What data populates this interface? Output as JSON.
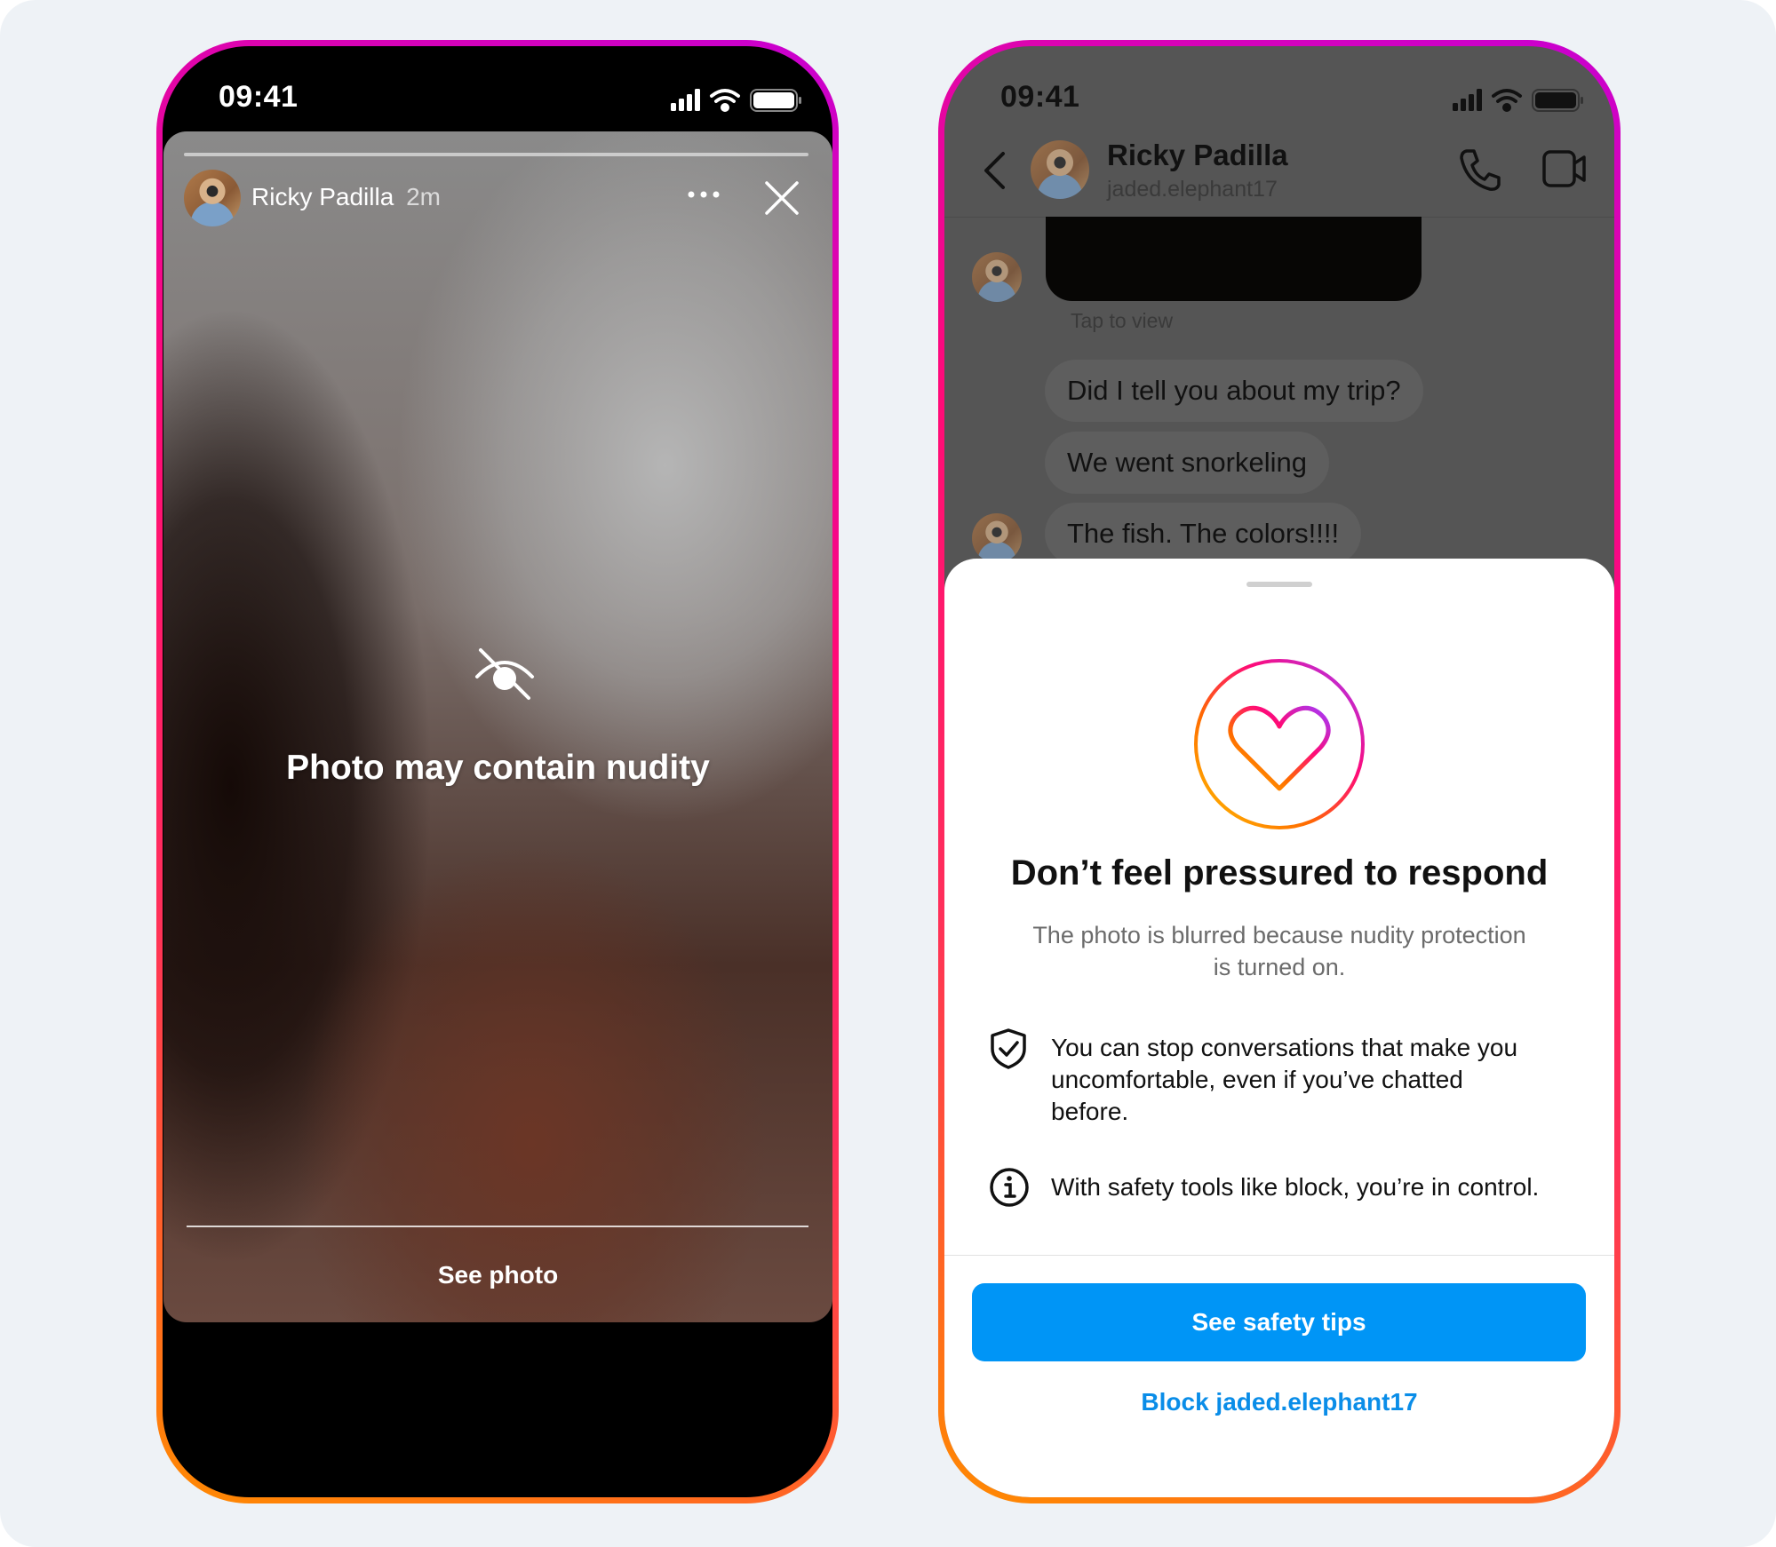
{
  "story_screen": {
    "status": {
      "time": "09:41"
    },
    "header": {
      "name": "Ricky Padilla",
      "time_ago": "2m"
    },
    "warning_title": "Photo may contain nudity",
    "see_photo": "See photo"
  },
  "chat_screen": {
    "status": {
      "time": "09:41"
    },
    "header": {
      "name": "Ricky Padilla",
      "username": "jaded.elephant17"
    },
    "tap_to_view": "Tap to view",
    "messages": [
      "Did I tell you about my trip?",
      "We went snorkeling",
      "The fish. The colors!!!!"
    ],
    "sheet": {
      "title": "Don’t feel pressured to respond",
      "subtitle_line1": "The photo is blurred because nudity protection",
      "subtitle_line2": "is turned on.",
      "tip1_lines": [
        "You can stop conversations that make you",
        "uncomfortable, even if you’ve chatted",
        "before."
      ],
      "tip2": "With safety tools like block, you’re in control.",
      "primary_button": "See safety tips",
      "block_link": "Block jaded.elephant17"
    }
  },
  "colors": {
    "accent": "#0095f6",
    "ring_gradient": [
      "#ff8a00",
      "#ff0a78",
      "#c800d0"
    ]
  }
}
